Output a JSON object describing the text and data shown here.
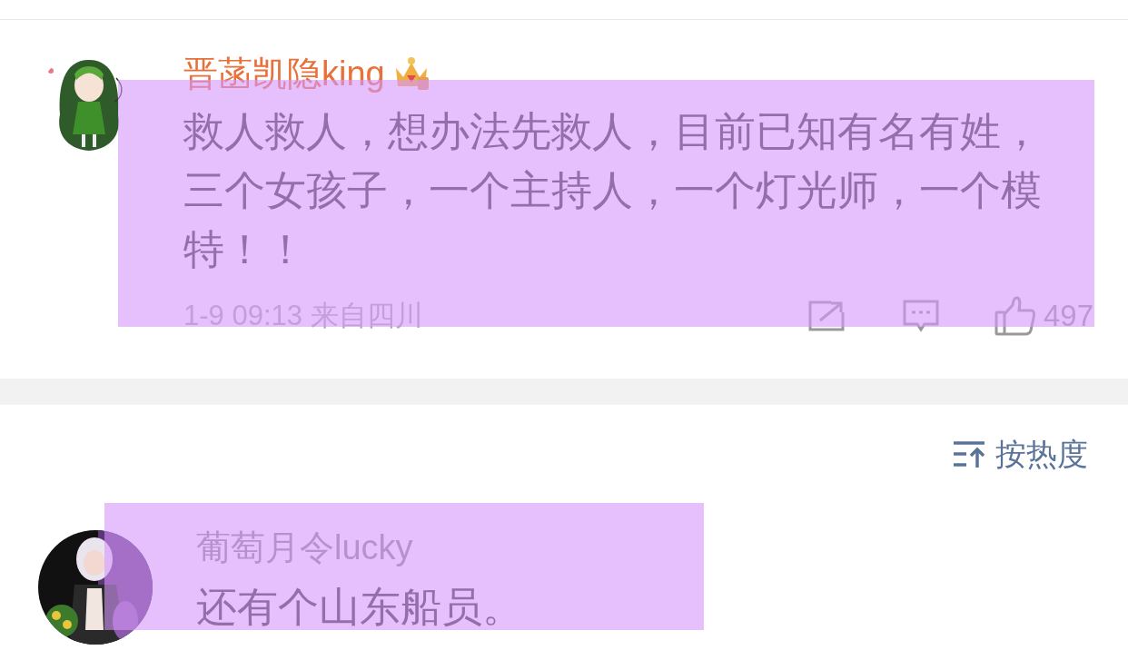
{
  "comments": [
    {
      "kind": "vip",
      "user": "晋菡凯隐king",
      "text": "救人救人，想办法先救人，目前已知有名有姓，三个女孩子，一个主持人，一个灯光师，一个模特！！",
      "meta": "1-9 09:13 来自四川",
      "likes": "497",
      "highlighted": true
    }
  ],
  "sort": {
    "label": "按热度"
  },
  "replies": [
    {
      "kind": "normal",
      "user": "葡萄月令lucky",
      "text": "还有个山东船员。",
      "highlighted": true
    }
  ]
}
